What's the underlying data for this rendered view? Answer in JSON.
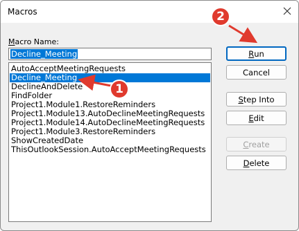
{
  "window": {
    "title": "Macros"
  },
  "form": {
    "label_underlined": "M",
    "label_rest": "acro Name:",
    "macro_name_value": "Decline_Meeting"
  },
  "macros": [
    "AutoAcceptMeetingRequests",
    "Decline_Meeting",
    "DeclineAndDelete",
    "FindFolder",
    "Project1.Module1.RestoreReminders",
    "Project1.Module13.AutoDeclineMeetingRequests",
    "Project1.Module14.AutoDeclineMeetingRequests",
    "Project1.Module3.RestoreReminders",
    "ShowCreatedDate",
    "ThisOutlookSession.AutoAcceptMeetingRequests"
  ],
  "selected_index": 1,
  "buttons": {
    "run": {
      "u": "R",
      "rest": "un"
    },
    "cancel": {
      "label": "Cancel"
    },
    "step_into": {
      "u": "S",
      "rest": "tep Into"
    },
    "edit": {
      "u": "E",
      "rest": "dit"
    },
    "create": {
      "u": "C",
      "rest": "reate"
    },
    "delete": {
      "u": "D",
      "rest": "elete"
    }
  },
  "annotations": {
    "badge_1": "1",
    "badge_2": "2",
    "color": "#e03a2e"
  }
}
